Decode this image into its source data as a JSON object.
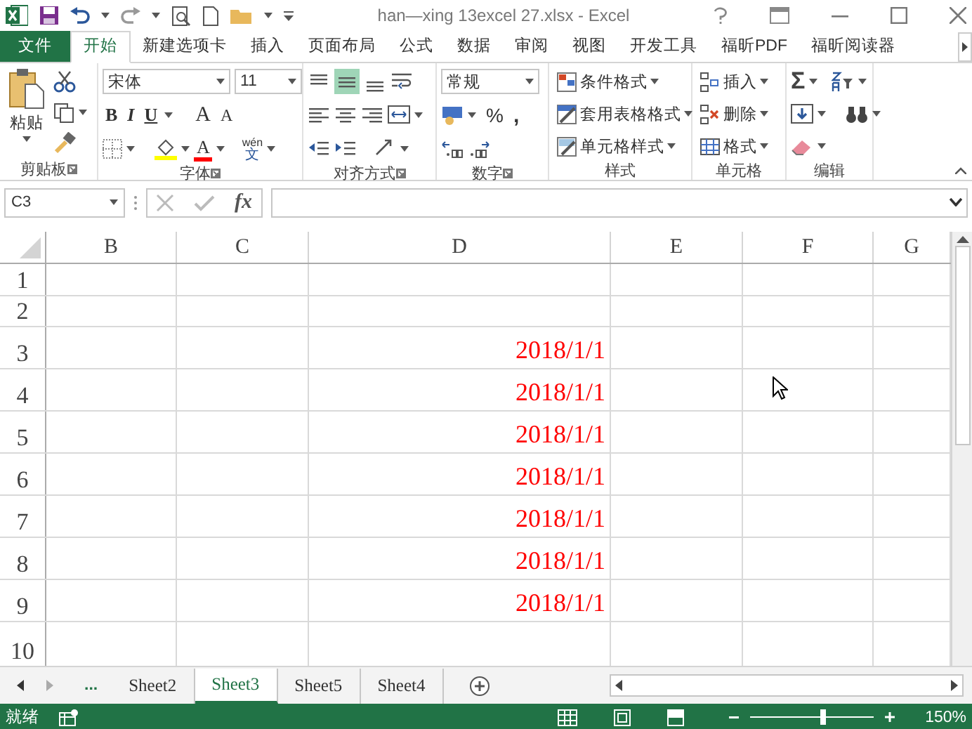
{
  "window": {
    "title": "han—xing 13excel 27.xlsx - Excel"
  },
  "ribbon_tabs": [
    {
      "label": "文件",
      "kind": "file",
      "selected": false
    },
    {
      "label": "开始",
      "kind": "tab",
      "selected": true
    },
    {
      "label": "新建选项卡",
      "kind": "tab",
      "selected": false
    },
    {
      "label": "插入",
      "kind": "tab",
      "selected": false
    },
    {
      "label": "页面布局",
      "kind": "tab",
      "selected": false
    },
    {
      "label": "公式",
      "kind": "tab",
      "selected": false
    },
    {
      "label": "数据",
      "kind": "tab",
      "selected": false
    },
    {
      "label": "审阅",
      "kind": "tab",
      "selected": false
    },
    {
      "label": "视图",
      "kind": "tab",
      "selected": false
    },
    {
      "label": "开发工具",
      "kind": "tab",
      "selected": false
    },
    {
      "label": "福昕PDF",
      "kind": "tab",
      "selected": false
    },
    {
      "label": "福昕阅读器",
      "kind": "tab",
      "selected": false
    }
  ],
  "clipboard": {
    "paste": "粘贴",
    "label": "剪贴板"
  },
  "font": {
    "name": "宋体",
    "size": "11",
    "bold": "B",
    "italic": "I",
    "underline": "U",
    "grow": "A",
    "shrink": "A",
    "font_color": "A",
    "phonetic": "wén",
    "phonetic_char": "文",
    "label": "字体"
  },
  "alignment": {
    "label": "对齐方式"
  },
  "number": {
    "format": "常规",
    "percent": "%",
    "comma": ",",
    "label": "数字"
  },
  "styles": {
    "items": [
      "条件格式",
      "套用表格格式",
      "单元格样式"
    ],
    "label": "样式"
  },
  "cells": {
    "items": [
      "插入",
      "删除",
      "格式"
    ],
    "label": "单元格"
  },
  "editing": {
    "sum": "Σ",
    "label": "编辑"
  },
  "formula_bar": {
    "name_box": "C3",
    "fx": "fx"
  },
  "sheet": {
    "columns": [
      "B",
      "C",
      "D",
      "E",
      "F",
      "G"
    ],
    "rows": [
      {
        "number": "1"
      },
      {
        "number": "2"
      },
      {
        "number": "3",
        "D": "2018/1/1"
      },
      {
        "number": "4",
        "D": "2018/1/1"
      },
      {
        "number": "5",
        "D": "2018/1/1"
      },
      {
        "number": "6",
        "D": "2018/1/1"
      },
      {
        "number": "7",
        "D": "2018/1/1"
      },
      {
        "number": "8",
        "D": "2018/1/1"
      },
      {
        "number": "9",
        "D": "2018/1/1"
      },
      {
        "number": "10"
      }
    ]
  },
  "sheet_tabs": [
    {
      "label": "...",
      "kind": "more"
    },
    {
      "label": "Sheet2",
      "kind": "sheet",
      "selected": false
    },
    {
      "label": "Sheet3",
      "kind": "sheet",
      "selected": true
    },
    {
      "label": "Sheet5",
      "kind": "sheet",
      "selected": false
    },
    {
      "label": "Sheet4",
      "kind": "sheet",
      "selected": false
    }
  ],
  "status_bar": {
    "status": "就绪",
    "zoom": "150%",
    "zoom_slider": {
      "level": 0.6
    }
  }
}
